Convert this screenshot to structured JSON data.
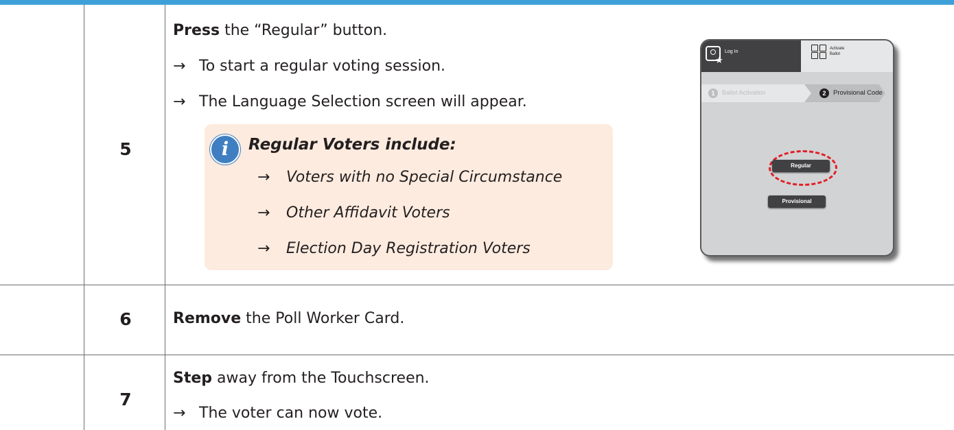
{
  "steps": [
    {
      "number": "5",
      "lines": [
        {
          "bold": "Press",
          "text": " the “Regular” button."
        },
        {
          "arrow": "→",
          "text": "To start a regular voting session."
        },
        {
          "arrow": "→",
          "text": "The Language Selection screen will appear."
        }
      ],
      "info": {
        "icon": "info-icon",
        "title": "Regular Voters include:",
        "items": [
          {
            "arrow": "→",
            "text": "Voters with no Special Circumstance"
          },
          {
            "arrow": "→",
            "text": "Other Affidavit Voters"
          },
          {
            "arrow": "→",
            "text": "Election Day Registration Voters"
          }
        ]
      },
      "device": {
        "login_label": "Log In",
        "activate_label": "Activate Ballot",
        "step1_number": "1",
        "step1_label": "Ballot Activation",
        "step2_number": "2",
        "step2_label": "Provisional Code",
        "regular_button": "Regular",
        "provisional_button": "Provisional"
      }
    },
    {
      "number": "6",
      "lines": [
        {
          "bold": "Remove",
          "text": " the Poll Worker Card."
        }
      ]
    },
    {
      "number": "7",
      "lines": [
        {
          "bold": "Step",
          "text": " away from the Touchscreen."
        },
        {
          "arrow": "→",
          "text": "The voter can now vote."
        }
      ]
    }
  ],
  "colors": {
    "top_bar": "#3ea0d8",
    "info_box": "#fdebdf",
    "info_icon": "#3f7fc1",
    "highlight": "#e31e25"
  }
}
